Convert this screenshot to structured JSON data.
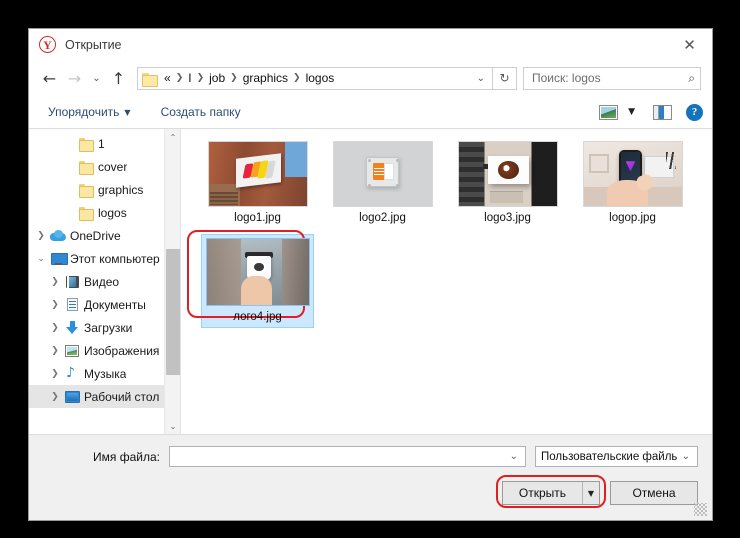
{
  "window": {
    "title": "Открытие",
    "logo_icon": "yandex-logo-icon",
    "close_label": "✕"
  },
  "nav": {
    "back_icon": "←",
    "forward_icon": "→",
    "history_icon": "⌄",
    "up_icon": "↑",
    "breadcrumbs": [
      "«",
      "I",
      "job",
      "graphics",
      "logos"
    ],
    "separator": "❯",
    "dropdown_icon": "⌄",
    "refresh_icon": "↻"
  },
  "search": {
    "placeholder": "Поиск: logos",
    "icon": "⌕"
  },
  "commandbar": {
    "organize_label": "Упорядочить",
    "organize_caret": "▼",
    "newfolder_label": "Создать папку",
    "view_icon": "view-layout-icon",
    "view_caret": "▼",
    "pane_icon": "preview-pane-icon",
    "help_label": "?"
  },
  "sidebar": {
    "items": [
      {
        "label": "1",
        "icon": "folder-icon",
        "indent": 2,
        "expander": "",
        "selected": false
      },
      {
        "label": "cover",
        "icon": "folder-icon",
        "indent": 2,
        "expander": "",
        "selected": false
      },
      {
        "label": "graphics",
        "icon": "folder-icon",
        "indent": 2,
        "expander": "",
        "selected": false
      },
      {
        "label": "logos",
        "icon": "folder-icon",
        "indent": 2,
        "expander": "",
        "selected": false
      },
      {
        "label": "OneDrive",
        "icon": "onedrive-icon",
        "indent": 0,
        "expander": "❯",
        "selected": false
      },
      {
        "label": "Этот компьютер",
        "icon": "computer-icon",
        "indent": 0,
        "expander": "⌄",
        "selected": false
      },
      {
        "label": "Видео",
        "icon": "video-icon",
        "indent": 1,
        "expander": "❯",
        "selected": false
      },
      {
        "label": "Документы",
        "icon": "documents-icon",
        "indent": 1,
        "expander": "❯",
        "selected": false
      },
      {
        "label": "Загрузки",
        "icon": "downloads-icon",
        "indent": 1,
        "expander": "❯",
        "selected": false
      },
      {
        "label": "Изображения",
        "icon": "pictures-icon",
        "indent": 1,
        "expander": "❯",
        "selected": false
      },
      {
        "label": "Музыка",
        "icon": "music-icon",
        "indent": 1,
        "expander": "❯",
        "selected": false
      },
      {
        "label": "Рабочий стол",
        "icon": "desktop-icon",
        "indent": 1,
        "expander": "❯",
        "selected": true
      }
    ],
    "scroll_up_icon": "⌃",
    "scroll_down_icon": "⌄"
  },
  "files": [
    {
      "name": "logo1.jpg",
      "art": "t1",
      "selected": false
    },
    {
      "name": "logo2.jpg",
      "art": "t2",
      "selected": false
    },
    {
      "name": "logo3.jpg",
      "art": "t3",
      "selected": false
    },
    {
      "name": "logop.jpg",
      "art": "t4",
      "selected": false
    },
    {
      "name": "лого4.jpg",
      "art": "t5",
      "selected": true
    }
  ],
  "form": {
    "filename_label": "Имя файла:",
    "filename_value": "",
    "filename_caret": "⌄",
    "filetype_value": "Пользовательские файлы",
    "filetype_caret": "⌄",
    "open_label": "Открыть",
    "open_split_caret": "▼",
    "cancel_label": "Отмена"
  },
  "highlights": {
    "color": "#e02020",
    "targets": [
      "selected-file-tile",
      "open-button"
    ]
  }
}
